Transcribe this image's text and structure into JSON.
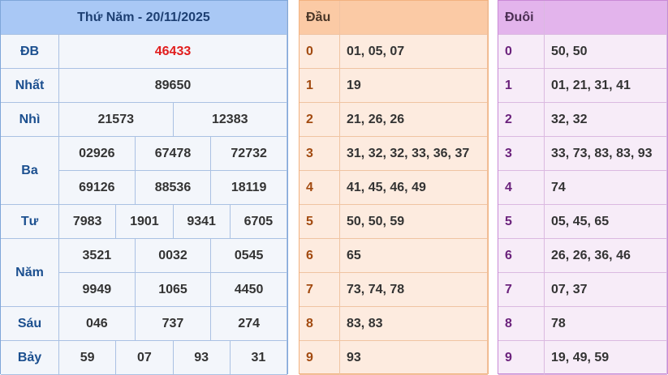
{
  "results": {
    "title": "Thứ Năm - 20/11/2025",
    "prizes": [
      {
        "label": "ĐB",
        "numbers": [
          "46433"
        ],
        "highlight": true
      },
      {
        "label": "Nhất",
        "numbers": [
          "89650"
        ]
      },
      {
        "label": "Nhì",
        "numbers": [
          "21573",
          "12383"
        ]
      },
      {
        "label": "Ba",
        "numbers": [
          "02926",
          "67478",
          "72732",
          "69126",
          "88536",
          "18119"
        ]
      },
      {
        "label": "Tư",
        "numbers": [
          "7983",
          "1901",
          "9341",
          "6705"
        ]
      },
      {
        "label": "Năm",
        "numbers": [
          "3521",
          "0032",
          "0545",
          "9949",
          "1065",
          "4450"
        ]
      },
      {
        "label": "Sáu",
        "numbers": [
          "046",
          "737",
          "274"
        ]
      },
      {
        "label": "Bảy",
        "numbers": [
          "59",
          "07",
          "93",
          "31"
        ]
      }
    ],
    "highlight_color": "#e11d1d"
  },
  "dau": {
    "header": "Đầu",
    "rows": [
      {
        "digit": "0",
        "values": "01, 05, 07"
      },
      {
        "digit": "1",
        "values": "19"
      },
      {
        "digit": "2",
        "values": "21, 26, 26"
      },
      {
        "digit": "3",
        "values": "31, 32, 32, 33, 36, 37"
      },
      {
        "digit": "4",
        "values": "41, 45, 46, 49"
      },
      {
        "digit": "5",
        "values": "50, 50, 59"
      },
      {
        "digit": "6",
        "values": "65"
      },
      {
        "digit": "7",
        "values": "73, 74, 78"
      },
      {
        "digit": "8",
        "values": "83, 83"
      },
      {
        "digit": "9",
        "values": "93"
      }
    ]
  },
  "duoi": {
    "header": "Đuôi",
    "rows": [
      {
        "digit": "0",
        "values": "50, 50"
      },
      {
        "digit": "1",
        "values": "01, 21, 31, 41"
      },
      {
        "digit": "2",
        "values": "32, 32"
      },
      {
        "digit": "3",
        "values": "33, 73, 83, 83, 93"
      },
      {
        "digit": "4",
        "values": "74"
      },
      {
        "digit": "5",
        "values": "05, 45, 65"
      },
      {
        "digit": "6",
        "values": "26, 26, 36, 46"
      },
      {
        "digit": "7",
        "values": "07, 37"
      },
      {
        "digit": "8",
        "values": "78"
      },
      {
        "digit": "9",
        "values": "19, 49, 59"
      }
    ]
  }
}
